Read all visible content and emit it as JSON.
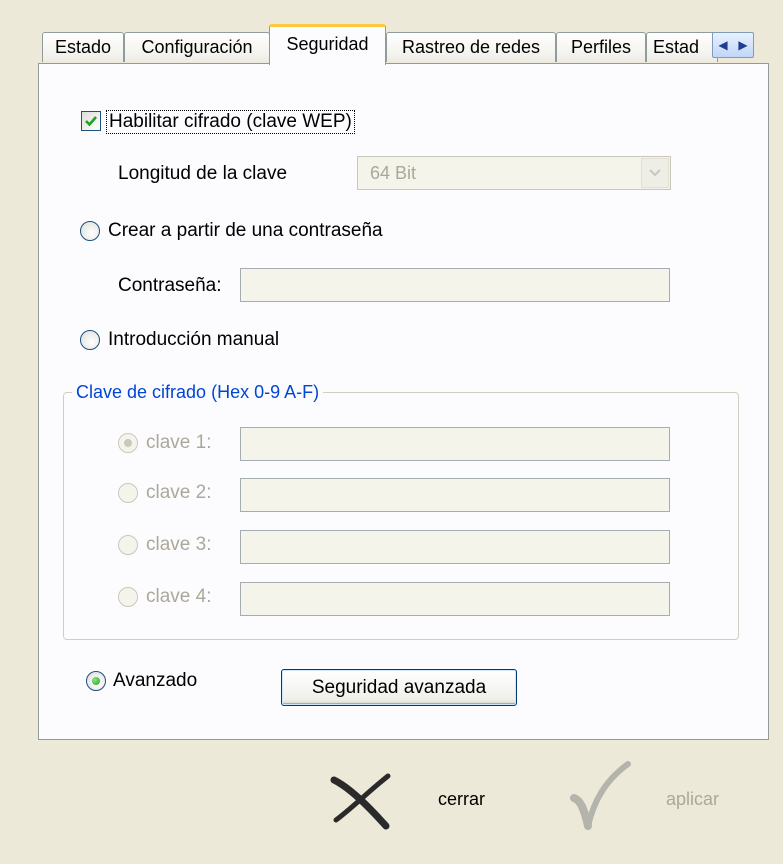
{
  "tabs": [
    {
      "label": "Estado"
    },
    {
      "label": "Configuración"
    },
    {
      "label": "Seguridad"
    },
    {
      "label": "Rastreo de redes"
    },
    {
      "label": "Perfiles"
    },
    {
      "label": "Estad"
    }
  ],
  "active_tab": "Seguridad",
  "security": {
    "enable_encryption_label": "Habilitar cifrado (clave WEP)",
    "enable_encryption_checked": true,
    "key_length_label": "Longitud de la clave",
    "key_length_value": "64 Bit",
    "create_from_password_label": "Crear a partir de una contraseña",
    "password_label": "Contraseña:",
    "password_value": "",
    "manual_entry_label": "Introducción manual",
    "encryption_key_group_title": "Clave de cifrado (Hex 0-9 A-F)",
    "keys": [
      {
        "label": "clave 1:",
        "value": "",
        "selected": true
      },
      {
        "label": "clave 2:",
        "value": "",
        "selected": false
      },
      {
        "label": "clave 3:",
        "value": "",
        "selected": false
      },
      {
        "label": "clave 4:",
        "value": "",
        "selected": false
      }
    ],
    "advanced_label": "Avanzado",
    "advanced_security_button": "Seguridad avanzada"
  },
  "footer": {
    "close_label": "cerrar",
    "apply_label": "aplicar"
  },
  "colors": {
    "background": "#ECE9D8",
    "panel": "#FCFCFE",
    "active_tab_accent": "#FFC83C",
    "group_title": "#0046D5",
    "disabled_text": "#ACA899"
  }
}
